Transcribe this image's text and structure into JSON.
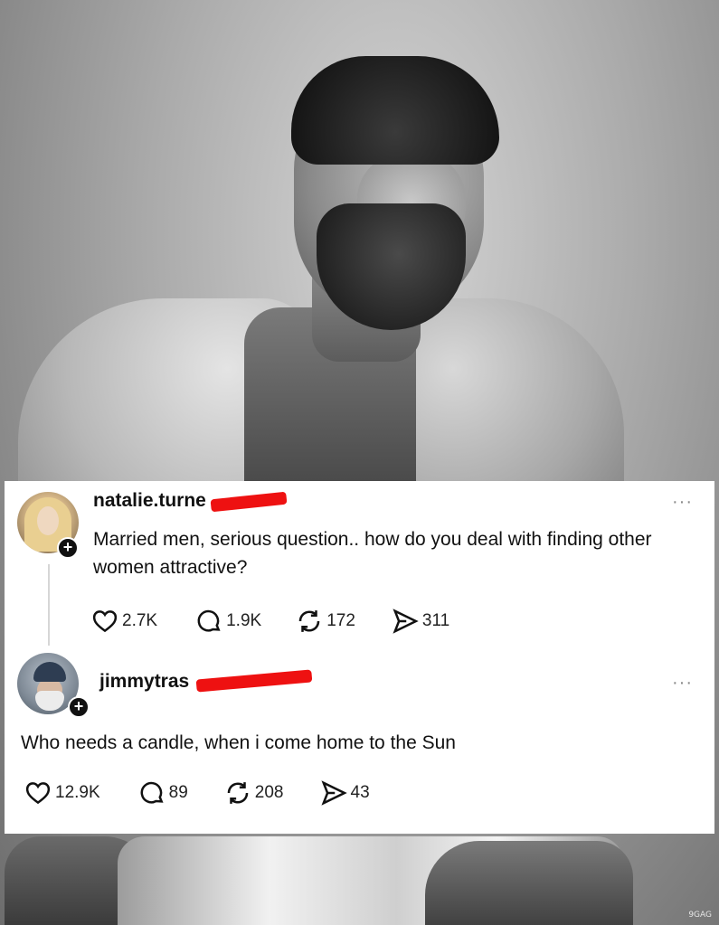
{
  "watermark": "9GAG",
  "posts": [
    {
      "username": "natalie.turne",
      "text": "Married men, serious question.. how do you deal with finding other women attractive?",
      "likes": "2.7K",
      "replies": "1.9K",
      "reposts": "172",
      "shares": "311"
    },
    {
      "username": "jimmytras",
      "text": "Who needs a candle, when i come home to the Sun",
      "likes": "12.9K",
      "replies": "89",
      "reposts": "208",
      "shares": "43"
    }
  ],
  "icons": {
    "more": "more-icon",
    "like": "heart-icon",
    "reply": "comment-icon",
    "repost": "repost-icon",
    "share": "send-icon",
    "follow": "plus-icon"
  },
  "colors": {
    "redaction": "#ee1111",
    "card_background": "#ffffff"
  }
}
